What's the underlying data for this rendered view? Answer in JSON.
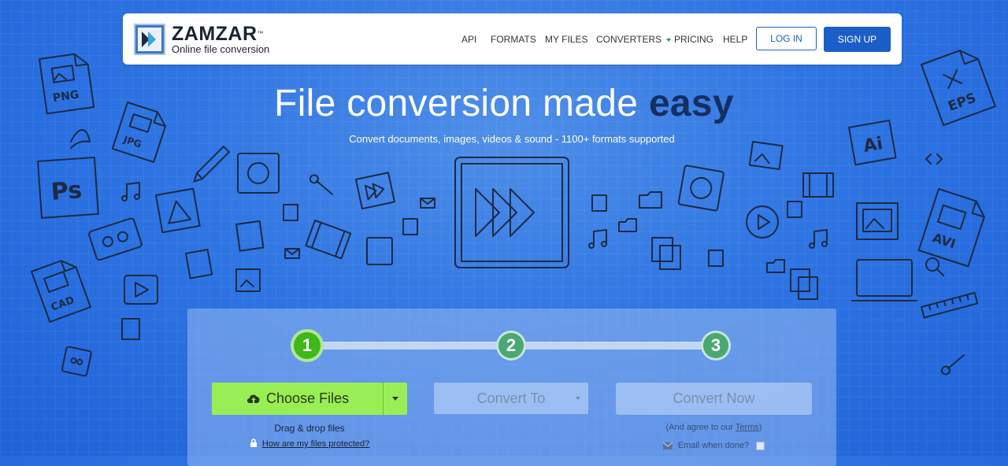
{
  "header": {
    "brand": "ZAMZAR",
    "trademark": "™",
    "tagline": "Online file conversion",
    "nav": [
      {
        "label": "API"
      },
      {
        "label": "FORMATS"
      },
      {
        "label": "MY FILES"
      },
      {
        "label": "CONVERTERS"
      },
      {
        "label": "PRICING"
      },
      {
        "label": "HELP"
      }
    ],
    "login_label": "LOG IN",
    "signup_label": "SIGN UP"
  },
  "hero": {
    "title_main": "File conversion made ",
    "title_emphasis": "easy",
    "subtitle": "Convert documents, images, videos & sound - 1100+ formats supported"
  },
  "doodles": {
    "labels": [
      "PNG",
      "JPG",
      "Ps",
      "CAD",
      "EPS",
      "Ai",
      "AVI"
    ]
  },
  "converter": {
    "steps": [
      "1",
      "2",
      "3"
    ],
    "active_step": 1,
    "choose_label": "Choose Files",
    "convert_to_label": "Convert To",
    "convert_now_label": "Convert Now",
    "drag_drop": "Drag & drop files",
    "protected_link": "How are my files protected?",
    "agree_prefix": "(And agree to our ",
    "terms_link": "Terms",
    "agree_suffix": ")",
    "email_label": "Email when done?"
  },
  "colors": {
    "background": "#2f75e3",
    "accent": "#1c5ec7",
    "choose_button": "#99ee55",
    "step_active": "#3fb81a",
    "step_inactive": "#4aa873",
    "emphasis": "#142f62"
  },
  "icons": [
    "logo-arrow-icon",
    "cloud-upload-icon",
    "lock-icon",
    "envelope-icon",
    "chevron-down-icon"
  ]
}
